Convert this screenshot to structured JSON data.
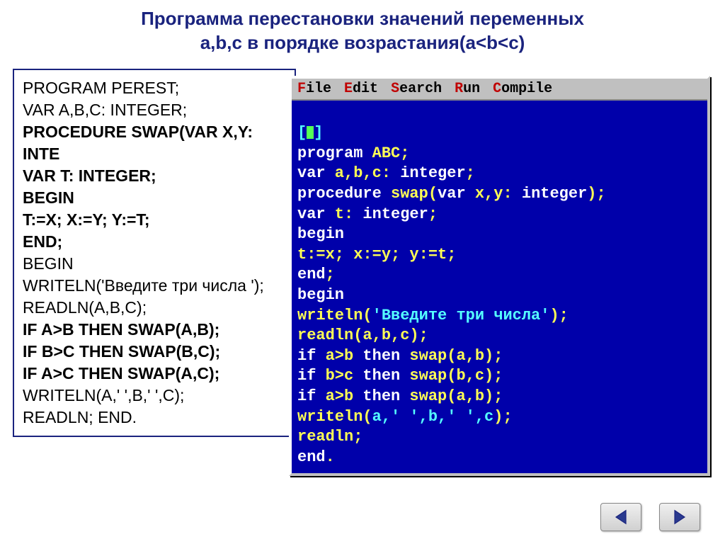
{
  "title_line1": "Программа перестановки значений переменных",
  "title_line2": "a,b,c в порядке возрастания(a<b<c)",
  "code_box": {
    "l1": "PROGRAM PEREST;",
    "l2": "VAR A,B,C: INTEGER;",
    "l3": "PROCEDURE SWAP(VAR X,Y: INTE",
    "l4": "VAR T: INTEGER;",
    "l5": "BEGIN",
    "l6": "T:=X; X:=Y; Y:=T;",
    "l7": "END;",
    "l8": "BEGIN",
    "l9": "WRITELN('Введите три числа ');",
    "l10": "READLN(A,B,C);",
    "l11": "IF A>B THEN SWAP(A,B);",
    "l12": "IF B>C THEN SWAP(B,C);",
    "l13": "IF A>C THEN SWAP(A,C);",
    "l14": "WRITELN(A,' ',B,' ',C);",
    "l15": "READLN;  END."
  },
  "ide": {
    "menu": {
      "file": "File",
      "file_h": "F",
      "edit": "Edit",
      "edit_h": "E",
      "search": "Search",
      "search_h": "S",
      "run": "Run",
      "run_h": "R",
      "compile": "Compile",
      "compile_h": "C"
    },
    "lines": {
      "bracket_l": "[",
      "bracket_r": "]",
      "l1_kw": "program",
      "l1_id": " ABC",
      "l1_p": ";",
      "l2_kw": "var",
      "l2_id": " a,b,c",
      "l2_p1": ": ",
      "l2_kw2": "integer",
      "l2_p2": ";",
      "l3_kw": "procedure",
      "l3_id": " swap",
      "l3_p1": "(",
      "l3_kw2": "var",
      "l3_id2": " x,y",
      "l3_p2": ": ",
      "l3_kw3": "integer",
      "l3_p3": ");",
      "l4_kw": "var",
      "l4_id": " t",
      "l4_p1": ": ",
      "l4_kw2": "integer",
      "l4_p2": ";",
      "l5_kw": "begin",
      "l6": "t:=x; x:=y; y:=t;",
      "l7_kw": "end",
      "l7_p": ";",
      "l8_kw": "begin",
      "l9_id": "writeln",
      "l9_p1": "(",
      "l9_str": "'Введите три числа'",
      "l9_p2": ");",
      "l10_id": "readln",
      "l10_p1": "(",
      "l10_args": "a,b,c",
      "l10_p2": ");",
      "l11_kw": "if",
      "l11_id1": " a>b ",
      "l11_kw2": "then",
      "l11_id2": " swap",
      "l11_p": "(a,b);",
      "l12_kw": "if",
      "l12_id1": " b>c ",
      "l12_kw2": "then",
      "l12_id2": " swap",
      "l12_p": "(b,c);",
      "l13_kw": "if",
      "l13_id1": " a>b ",
      "l13_kw2": "then",
      "l13_id2": " swap",
      "l13_p": "(a,b);",
      "l14_id": "writeln",
      "l14_p1": "(",
      "l14_args": "a,' ',b,' ',c",
      "l14_p2": ");",
      "l15_id": "readln",
      "l15_p": ";",
      "l16_kw": "end",
      "l16_p": "."
    }
  }
}
